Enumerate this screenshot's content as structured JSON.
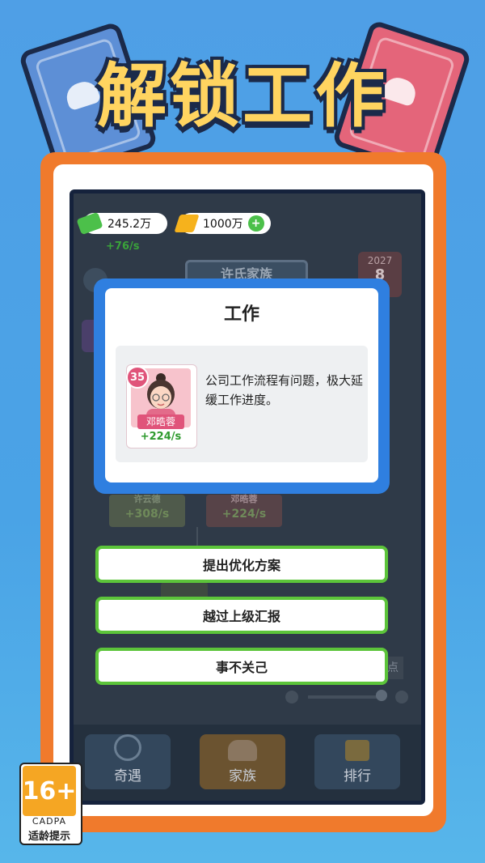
{
  "header": {
    "title": "解锁工作"
  },
  "hud": {
    "cash": "245.2万",
    "gold": "1000万",
    "cash_rate": "+76/s"
  },
  "background_game": {
    "family_banner": "许氏家族",
    "calendar_year": "2027",
    "calendar_value": "8",
    "card_left_rate": "+308/s",
    "card_right_rate": "+224/s",
    "card_left_name": "许云德",
    "card_right_name": "邓晧蓉",
    "side_label": "点"
  },
  "dialog": {
    "title": "工作",
    "employee": {
      "level": "35",
      "name": "邓晧蓉",
      "rate": "+224/s"
    },
    "description": "公司工作流程有问题，极大延缓工作进度。"
  },
  "options": [
    {
      "label": "提出优化方案"
    },
    {
      "label": "越过上级汇报"
    },
    {
      "label": "事不关己"
    }
  ],
  "bottom_nav": [
    {
      "label": "奇遇",
      "icon": "compass-icon"
    },
    {
      "label": "家族",
      "icon": "family-icon"
    },
    {
      "label": "排行",
      "icon": "trophy-icon"
    }
  ],
  "age_rating": {
    "age": "16+",
    "org": "CADPA",
    "note": "适龄提示"
  },
  "colors": {
    "accent_green": "#5cc43a",
    "dialog_blue": "#2f7fe0",
    "frame_orange": "#f07a2c",
    "title_yellow": "#ffd460"
  }
}
